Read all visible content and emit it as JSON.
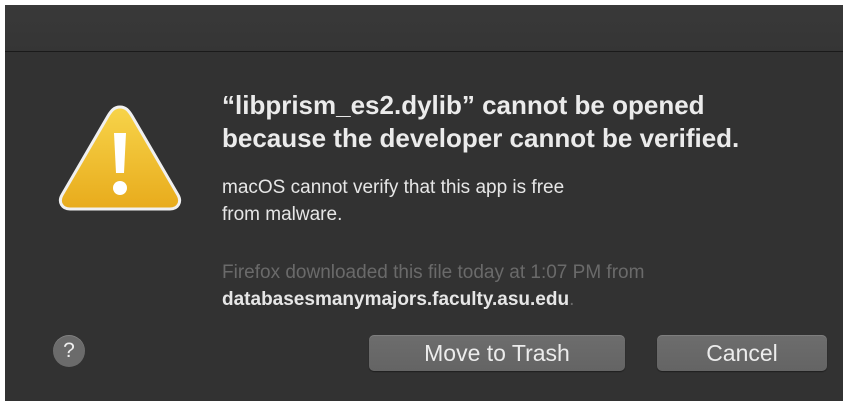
{
  "dialog": {
    "icon": "warning-triangle-icon",
    "title_line1": "“libprism_es2.dylib” cannot be opened",
    "title_line2": "because the developer cannot be verified.",
    "message_line1": "macOS cannot verify that this app is free",
    "message_line2": "from malware.",
    "info_line1": "Firefox downloaded this file today at 1:07 PM from",
    "info_domain": "databasesmanymajors.faculty.asu.edu",
    "info_period": "."
  },
  "buttons": {
    "help_label": "?",
    "trash_label": "Move to Trash",
    "cancel_label": "Cancel"
  },
  "colors": {
    "background": "#323232",
    "warning_yellow": "#f3c02a",
    "button": "#686868"
  }
}
